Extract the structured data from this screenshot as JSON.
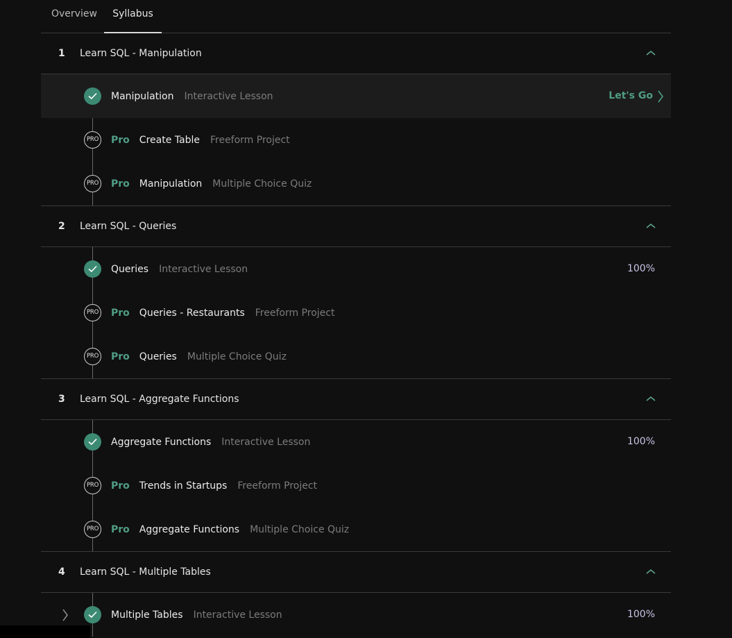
{
  "tabs": [
    {
      "label": "Overview",
      "active": false
    },
    {
      "label": "Syllabus",
      "active": true
    }
  ],
  "colors": {
    "accent": "#4f9d85",
    "check_bg": "#3d8a73",
    "percent": "#c8c4e6"
  },
  "modules": [
    {
      "number": "1",
      "title": "Learn SQL - Manipulation",
      "items": [
        {
          "status": "done",
          "pro": "",
          "name": "Manipulation",
          "type": "Interactive Lesson",
          "right": "Let's Go",
          "highlight": true
        },
        {
          "status": "pro",
          "pro_badge": "PRO",
          "pro": "Pro",
          "name": "Create Table",
          "type": "Freeform Project",
          "right": ""
        },
        {
          "status": "pro",
          "pro_badge": "PRO",
          "pro": "Pro",
          "name": "Manipulation",
          "type": "Multiple Choice Quiz",
          "right": ""
        }
      ]
    },
    {
      "number": "2",
      "title": "Learn SQL - Queries",
      "items": [
        {
          "status": "done",
          "pro": "",
          "name": "Queries",
          "type": "Interactive Lesson",
          "right": "100%"
        },
        {
          "status": "pro",
          "pro_badge": "PRO",
          "pro": "Pro",
          "name": "Queries - Restaurants",
          "type": "Freeform Project",
          "right": ""
        },
        {
          "status": "pro",
          "pro_badge": "PRO",
          "pro": "Pro",
          "name": "Queries",
          "type": "Multiple Choice Quiz",
          "right": ""
        }
      ]
    },
    {
      "number": "3",
      "title": "Learn SQL - Aggregate Functions",
      "items": [
        {
          "status": "done",
          "pro": "",
          "name": "Aggregate Functions",
          "type": "Interactive Lesson",
          "right": "100%"
        },
        {
          "status": "pro",
          "pro_badge": "PRO",
          "pro": "Pro",
          "name": "Trends in Startups",
          "type": "Freeform Project",
          "right": ""
        },
        {
          "status": "pro",
          "pro_badge": "PRO",
          "pro": "Pro",
          "name": "Aggregate Functions",
          "type": "Multiple Choice Quiz",
          "right": ""
        }
      ]
    },
    {
      "number": "4",
      "title": "Learn SQL - Multiple Tables",
      "items": [
        {
          "status": "done",
          "pro": "",
          "name": "Multiple Tables",
          "type": "Interactive Lesson",
          "right": "100%"
        }
      ]
    }
  ]
}
